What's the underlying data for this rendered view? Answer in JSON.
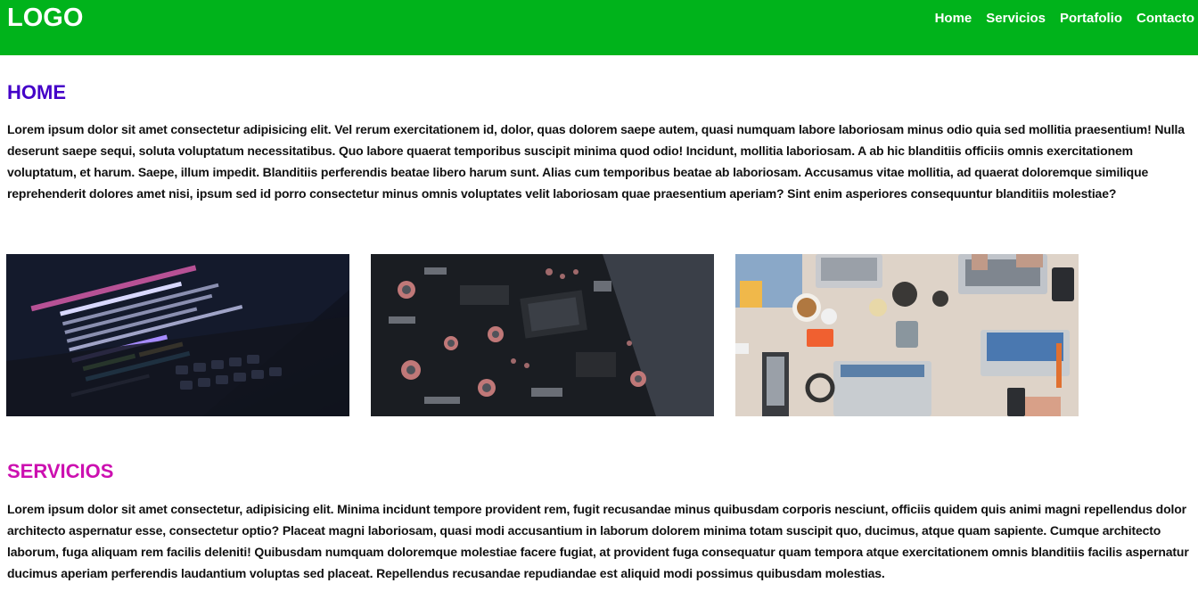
{
  "header": {
    "logo": "LOGO",
    "nav": [
      "Home",
      "Servicios",
      "Portafolio",
      "Contacto"
    ]
  },
  "home": {
    "title": "HOME",
    "text": "Lorem ipsum dolor sit amet consectetur adipisicing elit. Vel rerum exercitationem id, dolor, quas dolorem saepe autem, quasi numquam labore laboriosam minus odio quia sed mollitia praesentium! Nulla deserunt saepe sequi, soluta voluptatum necessitatibus. Quo labore quaerat temporibus suscipit minima quod odio! Incidunt, mollitia laboriosam. A ab hic blanditiis officiis omnis exercitationem voluptatum, et harum. Saepe, illum impedit. Blanditiis perferendis beatae libero harum sunt. Alias cum temporibus beatae ab laboriosam. Accusamus vitae mollitia, ad quaerat doloremque similique reprehenderit dolores amet nisi, ipsum sed id porro consectetur minus omnis voluptates velit laboriosam quae praesentium aperiam? Sint enim asperiores consequuntur blanditiis molestiae?",
    "images": [
      "code-on-laptop-photo",
      "circuit-board-photo",
      "team-with-laptops-photo"
    ]
  },
  "servicios": {
    "title": "SERVICIOS",
    "text": "Lorem ipsum dolor sit amet consectetur, adipisicing elit. Minima incidunt tempore provident rem, fugit recusandae minus quibusdam corporis nesciunt, officiis quidem quis animi magni repellendus dolor architecto aspernatur esse, consectetur optio? Placeat magni laboriosam, quasi modi accusantium in laborum dolorem minima totam suscipit quo, ducimus, atque quam sapiente. Cumque architecto laborum, fuga aliquam rem facilis deleniti! Quibusdam numquam doloremque molestiae facere fugiat, at provident fuga consequatur quam tempora atque exercitationem omnis blanditiis facilis aspernatur ducimus aperiam perferendis laudantium voluptas sed placeat. Repellendus recusandae repudiandae est aliquid modi possimus quibusdam molestias."
  },
  "colors": {
    "header_bg": "#00b31b",
    "home_title": "#4400c8",
    "servicios_title": "#cc10b0"
  }
}
